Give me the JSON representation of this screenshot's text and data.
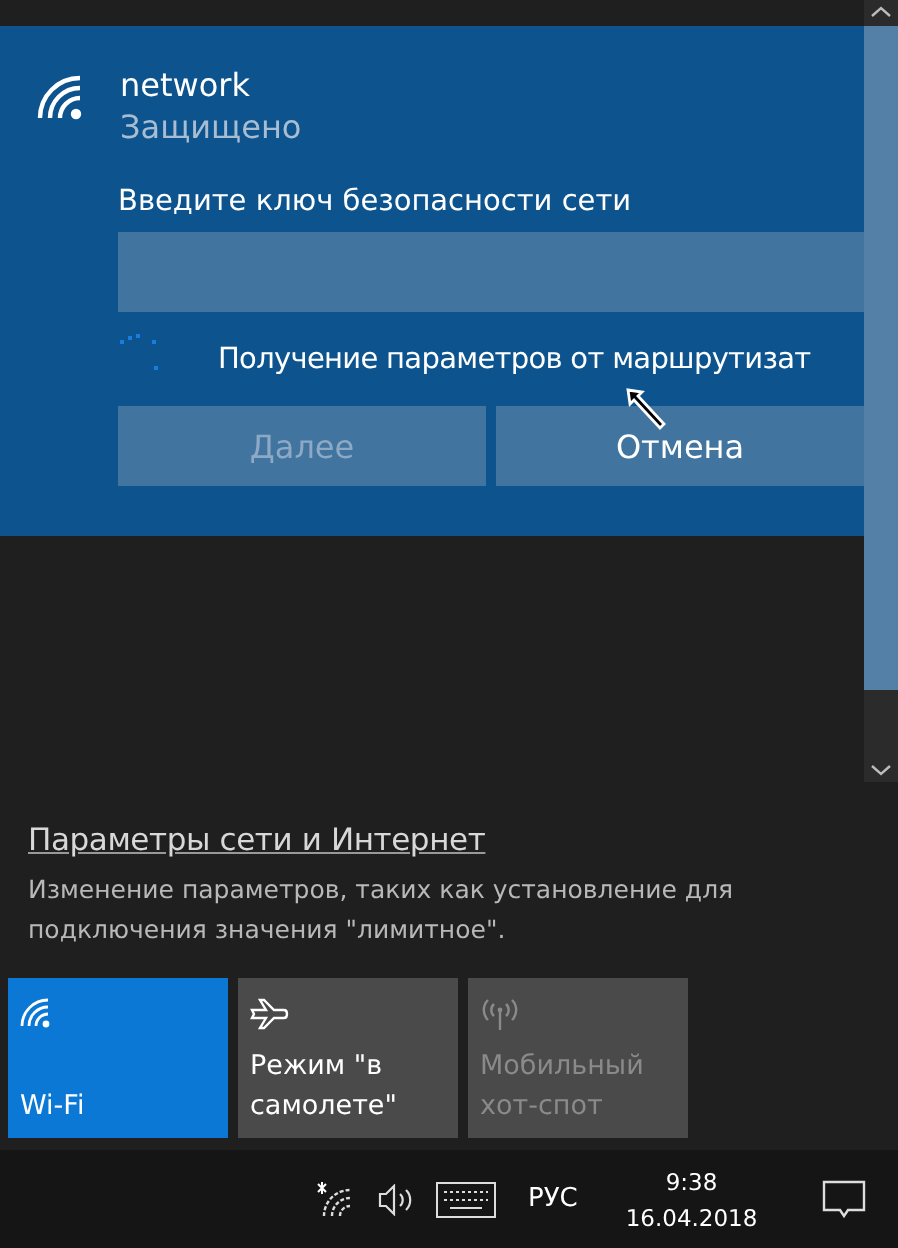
{
  "network": {
    "name": "network",
    "status": "Защищено",
    "prompt": "Введите ключ безопасности сети",
    "progress_text": "Получение параметров от маршрутизат",
    "buttons": [
      {
        "label": "Далее",
        "disabled": true
      },
      {
        "label": "Отмена",
        "disabled": false
      }
    ]
  },
  "settings_link": {
    "title": "Параметры сети и Интернет",
    "description": "Изменение параметров, таких как установление для подключения значения \"лимитное\"."
  },
  "tiles": [
    {
      "kind": "wifi",
      "label": "Wi-Fi",
      "selected": true,
      "disabled": false
    },
    {
      "kind": "airplane",
      "label": "Режим \"в самолете\"",
      "selected": false,
      "disabled": false
    },
    {
      "kind": "hotspot",
      "label": "Мобильный хот-спот",
      "selected": false,
      "disabled": true
    }
  ],
  "taskbar": {
    "language": "РУС",
    "time": "9:38",
    "date": "16.04.2018"
  }
}
